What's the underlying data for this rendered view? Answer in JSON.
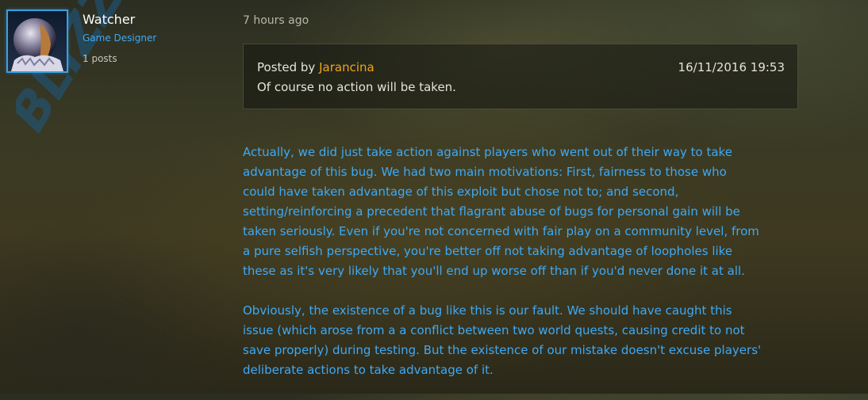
{
  "post": {
    "author": {
      "name": "Watcher",
      "role": "Game Designer",
      "post_count": "1 posts"
    },
    "watermark": {
      "text": "BLIZZARD"
    },
    "timestamp": "7 hours ago",
    "quote": {
      "prefix": "Posted by",
      "author": "Jarancina",
      "date": "16/11/2016 19:53",
      "text": "Of course no action will be taken."
    },
    "body": {
      "paragraph1_lines": [
        "Actually, we did just take action against players who went out of their way to take",
        "advantage of this bug. We had two main motivations: First, fairness to those who",
        "could have taken advantage of this exploit but chose not to; and second,",
        "setting/reinforcing a precedent that flagrant abuse of bugs for personal gain will be",
        "taken seriously. Even if you're not concerned with fair play on a community level, from",
        "a pure selfish perspective, you're better off not taking advantage of loopholes like",
        "these as it's very likely that you'll end up worse off than if you'd never done it at all."
      ],
      "paragraph2_lines": [
        "Obviously, the existence of a bug like this is our fault. We should have caught this",
        "issue (which arose from a a conflict between two world quests, causing credit to not",
        "save properly) during testing. But the existence of our mistake doesn't excuse players'",
        "deliberate actions to take advantage of it."
      ]
    }
  },
  "colors": {
    "blue_text": "#3ea9f5",
    "orange_author": "#f0a419",
    "avatar_border": "#3aa0e0"
  }
}
